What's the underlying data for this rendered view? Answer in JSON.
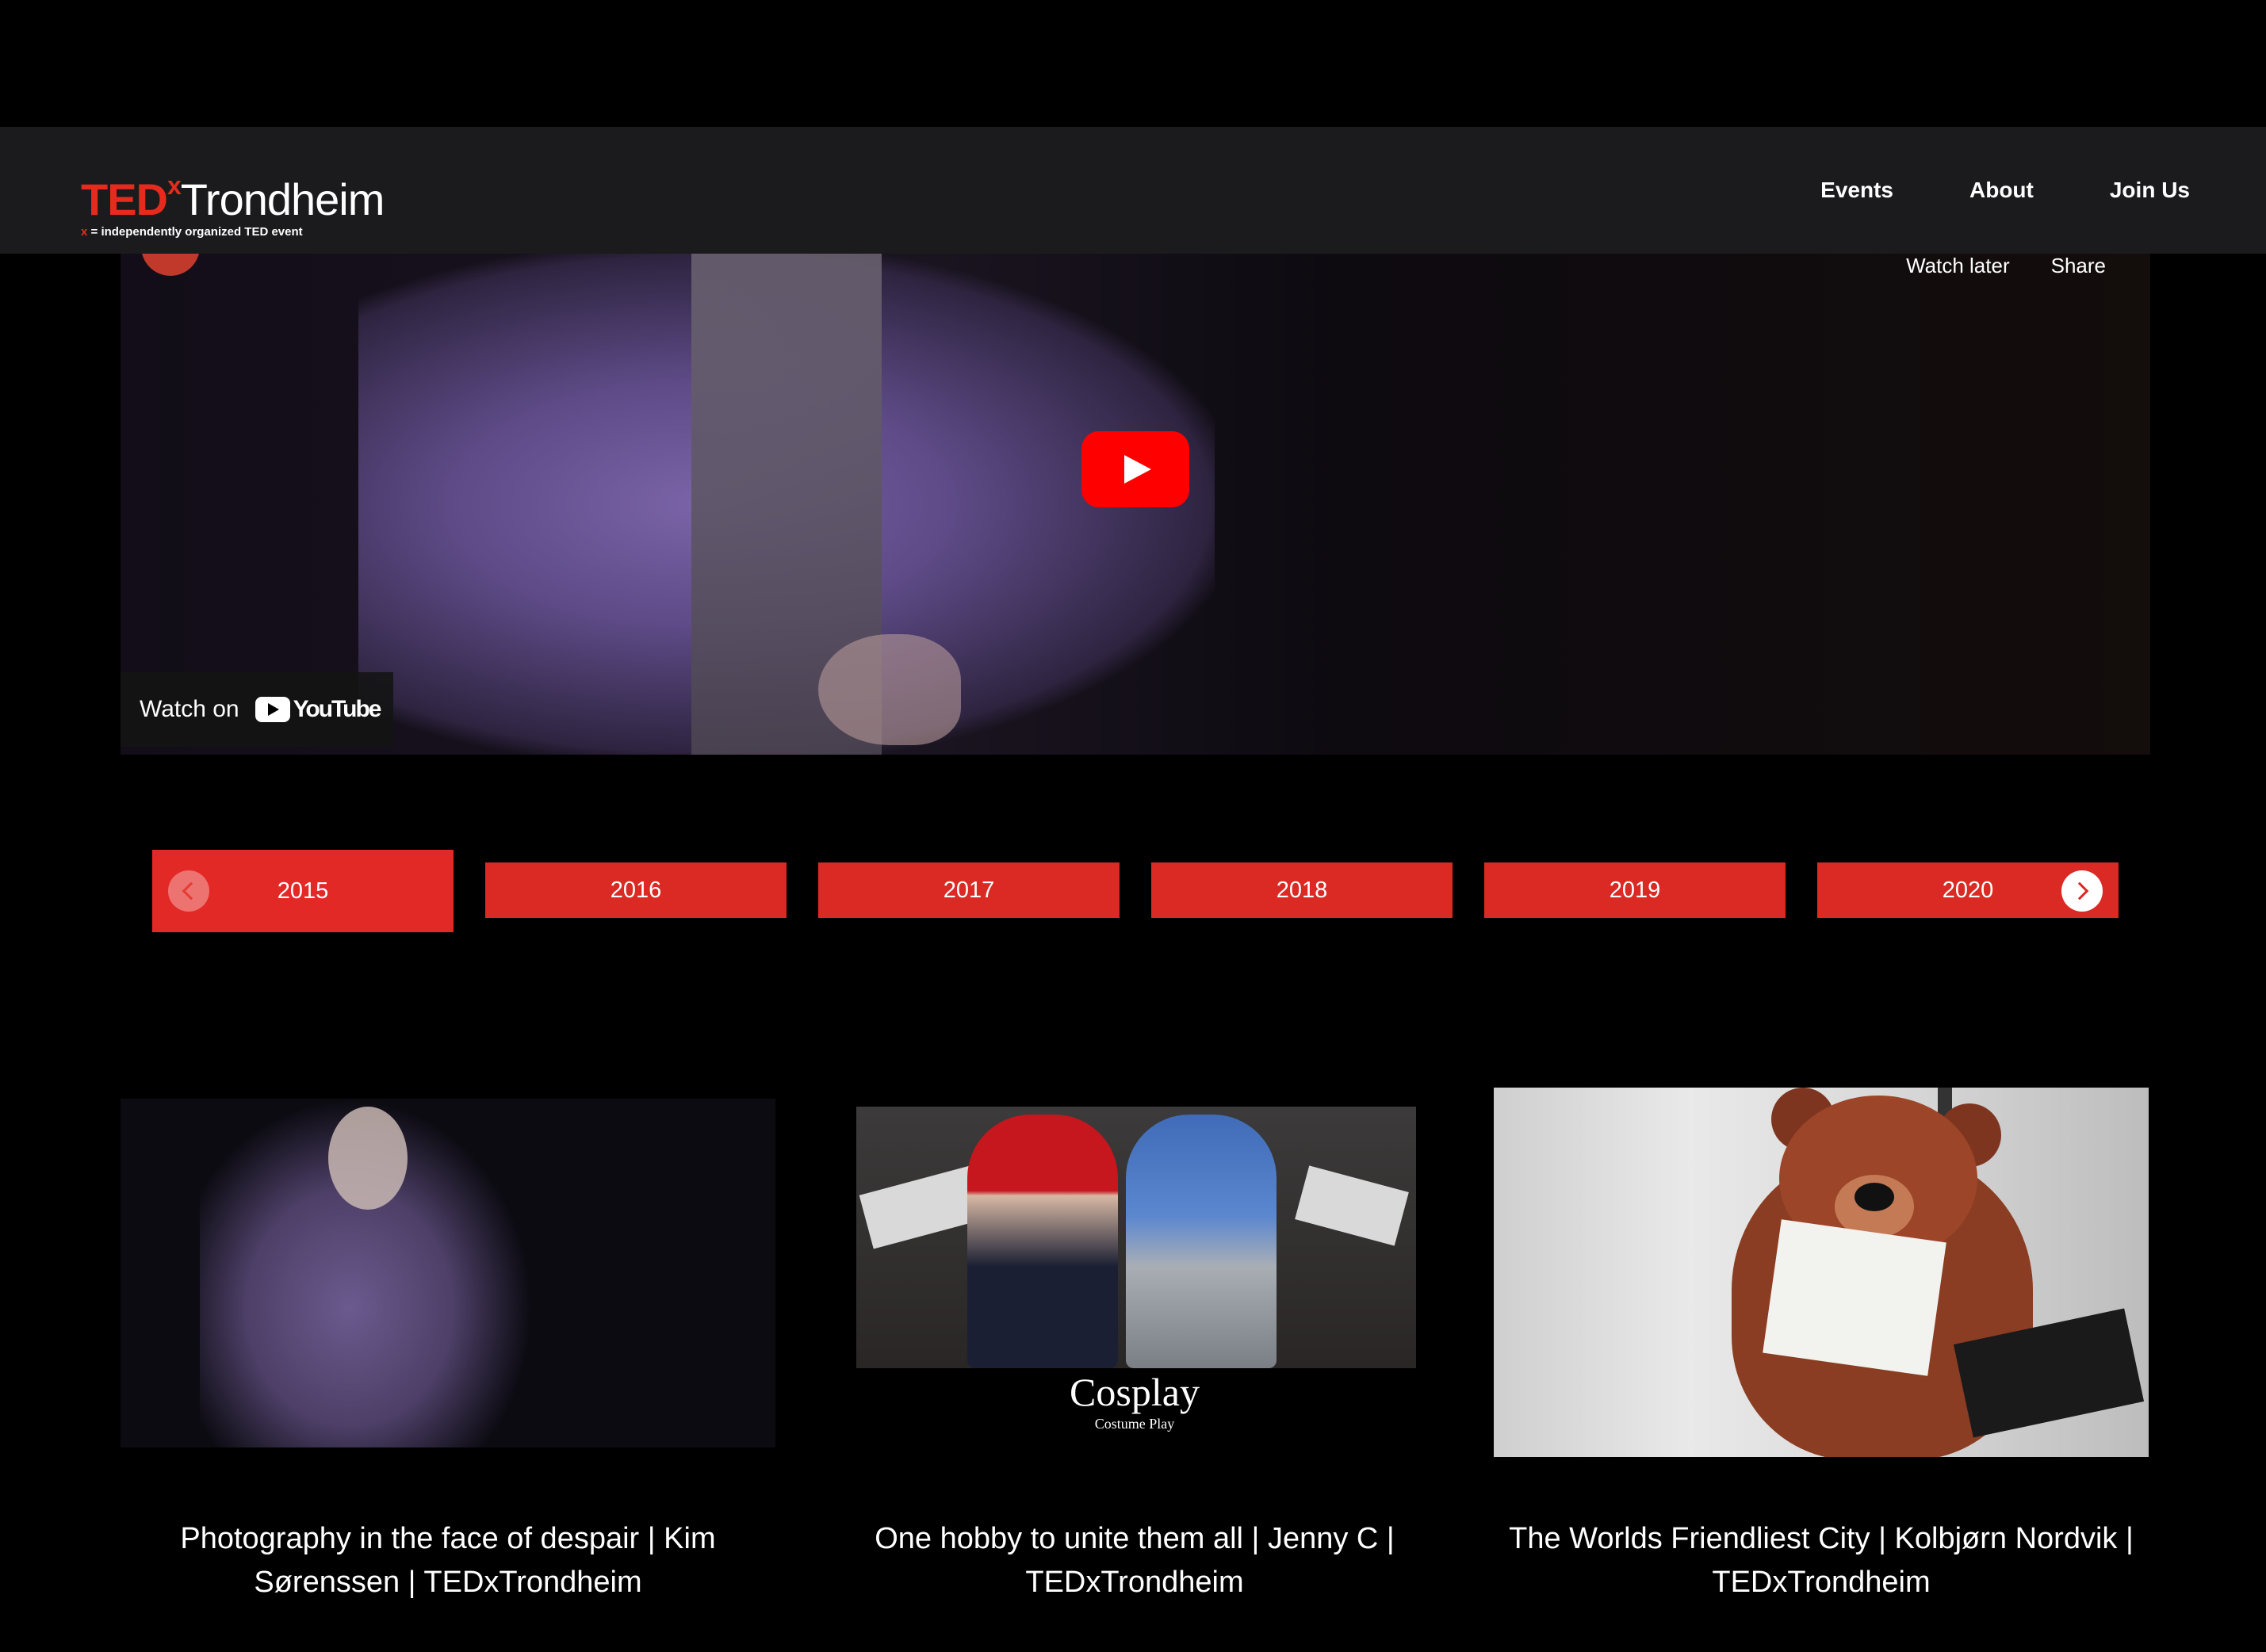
{
  "header": {
    "logo": {
      "ted": "TED",
      "x": "x",
      "city": "Trondheim",
      "tagline_x": "x",
      "tagline": " = independently organized TED event"
    },
    "nav": [
      "Events",
      "About",
      "Join Us"
    ]
  },
  "video": {
    "actions": [
      "Watch later",
      "Share"
    ],
    "watch_on": "Watch on",
    "youtube": "YouTube"
  },
  "years": [
    "2015",
    "2016",
    "2017",
    "2018",
    "2019",
    "2020"
  ],
  "active_year": "2015",
  "cards": [
    {
      "title": "Photography in the face of despair | Kim Sørenssen | TEDxTrondheim"
    },
    {
      "title": "One hobby to unite them all | Jenny C | TEDxTrondheim",
      "thumb_caption": "Cosplay",
      "thumb_subcaption": "Costume Play"
    },
    {
      "title": "The Worlds Friendliest City | Kolbjørn Nordvik | TEDxTrondheim"
    }
  ],
  "colors": {
    "brand_red": "#e62b1e",
    "year_button": "#db2a24",
    "navbar_bg": "#1b1b1d",
    "youtube_red": "#ff0000"
  }
}
